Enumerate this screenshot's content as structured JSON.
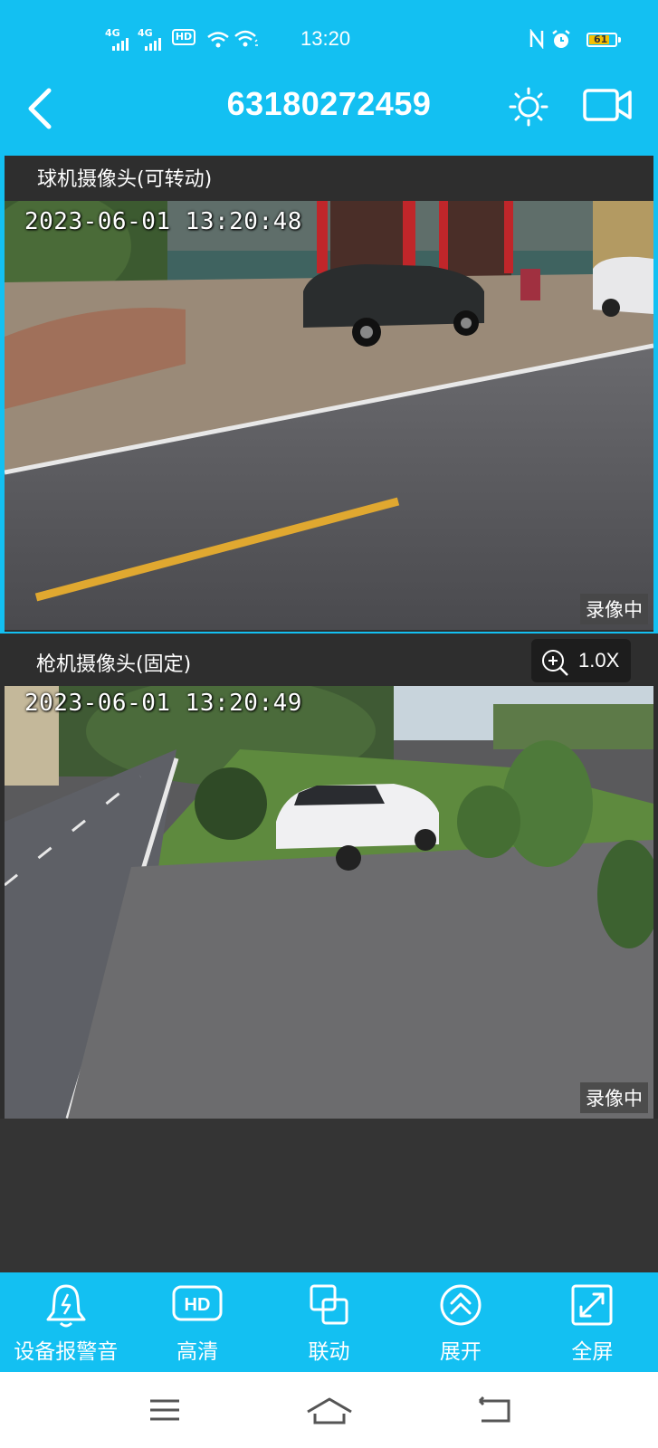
{
  "status_bar": {
    "sim1": "4G",
    "sim2": "4G",
    "hd": "HD",
    "time": "13:20",
    "battery": "61"
  },
  "header": {
    "title": "63180272459"
  },
  "cameras": [
    {
      "label": "球机摄像头(可转动)",
      "timestamp": "2023-06-01 13:20:48",
      "recording": "录像中"
    },
    {
      "label": "枪机摄像头(固定)",
      "timestamp": "2023-06-01 13:20:49",
      "recording": "录像中",
      "zoom": "1.0X"
    }
  ],
  "toolbar": [
    {
      "label": "设备报警音",
      "icon": "alarm-bell-icon"
    },
    {
      "label": "高清",
      "icon": "hd-icon"
    },
    {
      "label": "联动",
      "icon": "link-squares-icon"
    },
    {
      "label": "展开",
      "icon": "expand-chevrons-icon"
    },
    {
      "label": "全屏",
      "icon": "fullscreen-icon"
    }
  ],
  "colors": {
    "accent": "#13c0f2",
    "background": "#343434"
  }
}
